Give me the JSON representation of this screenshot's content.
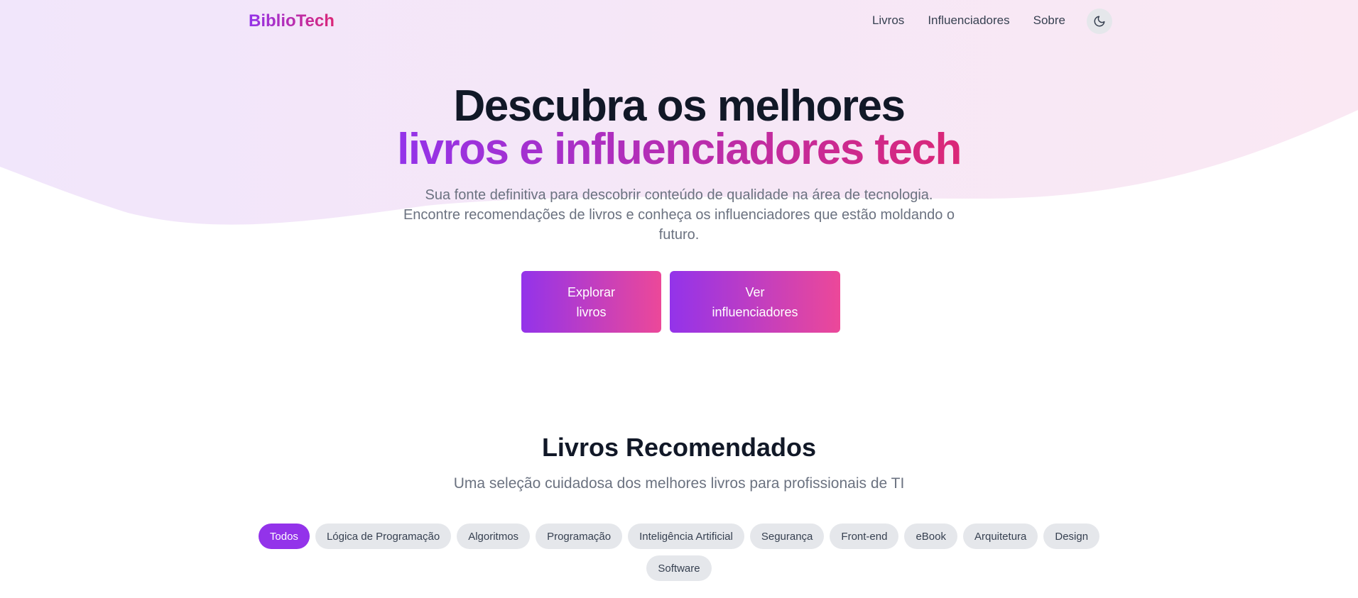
{
  "nav": {
    "brand": "BiblioTech",
    "links": [
      "Livros",
      "Influenciadores",
      "Sobre"
    ]
  },
  "hero": {
    "title_line1": "Descubra os melhores",
    "title_line2": "livros e influenciadores tech",
    "subtitle": "Sua fonte definitiva para descobrir conteúdo de qualidade na área de tecnologia. Encontre recomendações de livros e conheça os influenciadores que estão moldando o futuro.",
    "buttons": {
      "explore": "Explorar livros",
      "influencers": "Ver influenciadores"
    }
  },
  "books": {
    "title": "Livros Recomendados",
    "subtitle": "Uma seleção cuidadosa dos melhores livros para profissionais de TI",
    "filters": [
      "Todos",
      "Lógica de Programação",
      "Algoritmos",
      "Programação",
      "Inteligência Artificial",
      "Segurança",
      "Front-end",
      "eBook",
      "Arquitetura",
      "Design",
      "Software"
    ],
    "active_filter": "Todos"
  },
  "colors": {
    "accent_purple": "#9333ea",
    "accent_pink": "#ec4899",
    "hero_bg": "#f5e8fb"
  },
  "icons": {
    "theme_toggle": "moon-icon"
  }
}
